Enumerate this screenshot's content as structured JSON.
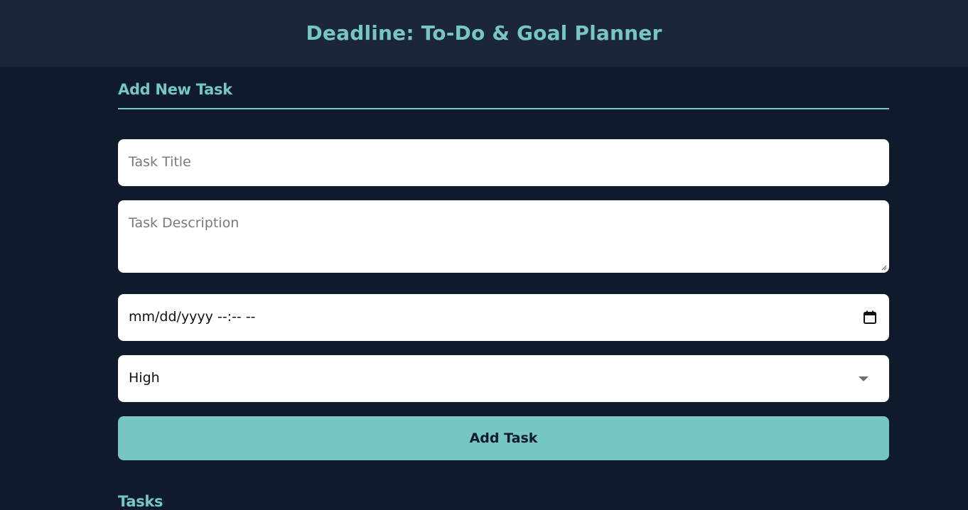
{
  "header": {
    "title": "Deadline: To-Do & Goal Planner"
  },
  "add_task_section": {
    "heading": "Add New Task",
    "title_field": {
      "placeholder": "Task Title",
      "value": ""
    },
    "description_field": {
      "placeholder": "Task Description",
      "value": ""
    },
    "due_date_field": {
      "display": "mm/dd/yyyy --:-- --",
      "icon": "calendar-icon"
    },
    "priority_select": {
      "selected": "High",
      "icon": "chevron-down-icon"
    },
    "submit_label": "Add Task"
  },
  "tasks_section": {
    "heading": "Tasks"
  },
  "colors": {
    "background": "#0f1b2b",
    "header_background": "#1c263b",
    "accent": "#76c7c0",
    "field_background": "#ffffff"
  }
}
